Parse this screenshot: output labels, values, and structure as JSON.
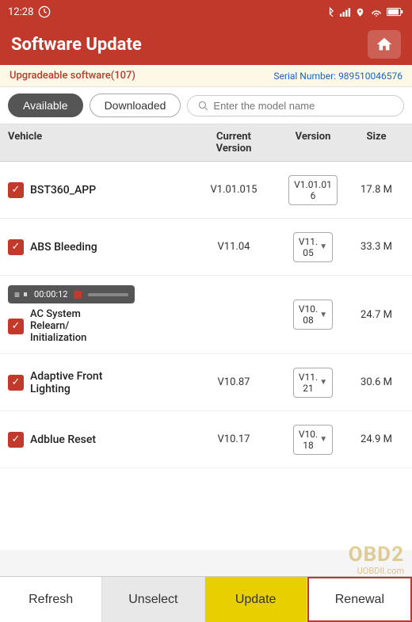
{
  "statusBar": {
    "time": "12:28",
    "icons": [
      "bluetooth",
      "signal",
      "wifi",
      "battery"
    ]
  },
  "header": {
    "title": "Software Update",
    "homeIcon": "🏠"
  },
  "subheader": {
    "upgradeable": "Upgradeable software(107)",
    "serialLabel": "Serial Number:",
    "serialNumber": "989510046576"
  },
  "tabs": {
    "available": "Available",
    "downloaded": "Downloaded",
    "searchPlaceholder": "Enter the model name"
  },
  "tableHeader": {
    "vehicle": "Vehicle",
    "currentVersion": "Current Version",
    "version": "Version",
    "size": "Size"
  },
  "rows": [
    {
      "vehicle": "BST360_APP",
      "currentVersion": "V1.01.015",
      "version": "V1.01.016",
      "size": "17.8 M",
      "checked": true,
      "hasDropdown": false,
      "inProgress": false
    },
    {
      "vehicle": "ABS Bleeding",
      "currentVersion": "V11.04",
      "version": "V11.\n05",
      "size": "33.3 M",
      "checked": true,
      "hasDropdown": true,
      "inProgress": false
    },
    {
      "vehicle": "AC System Relearn/ Initialization",
      "currentVersion": "",
      "version": "V10.\n08",
      "size": "24.7 M",
      "checked": true,
      "hasDropdown": true,
      "inProgress": true,
      "progressTime": "00:00:12"
    },
    {
      "vehicle": "Adaptive Front Lighting",
      "currentVersion": "V10.87",
      "version": "V11.\n21",
      "size": "30.6 M",
      "checked": true,
      "hasDropdown": true,
      "inProgress": false
    },
    {
      "vehicle": "Adblue Reset",
      "currentVersion": "V10.17",
      "version": "V10.\n18",
      "size": "24.9 M",
      "checked": true,
      "hasDropdown": true,
      "inProgress": false
    }
  ],
  "toolbar": {
    "refresh": "Refresh",
    "unselect": "Unselect",
    "update": "Update",
    "renewal": "Renewal"
  },
  "watermark": {
    "text1": "OBD2",
    "text2": "UOBDII.com"
  }
}
